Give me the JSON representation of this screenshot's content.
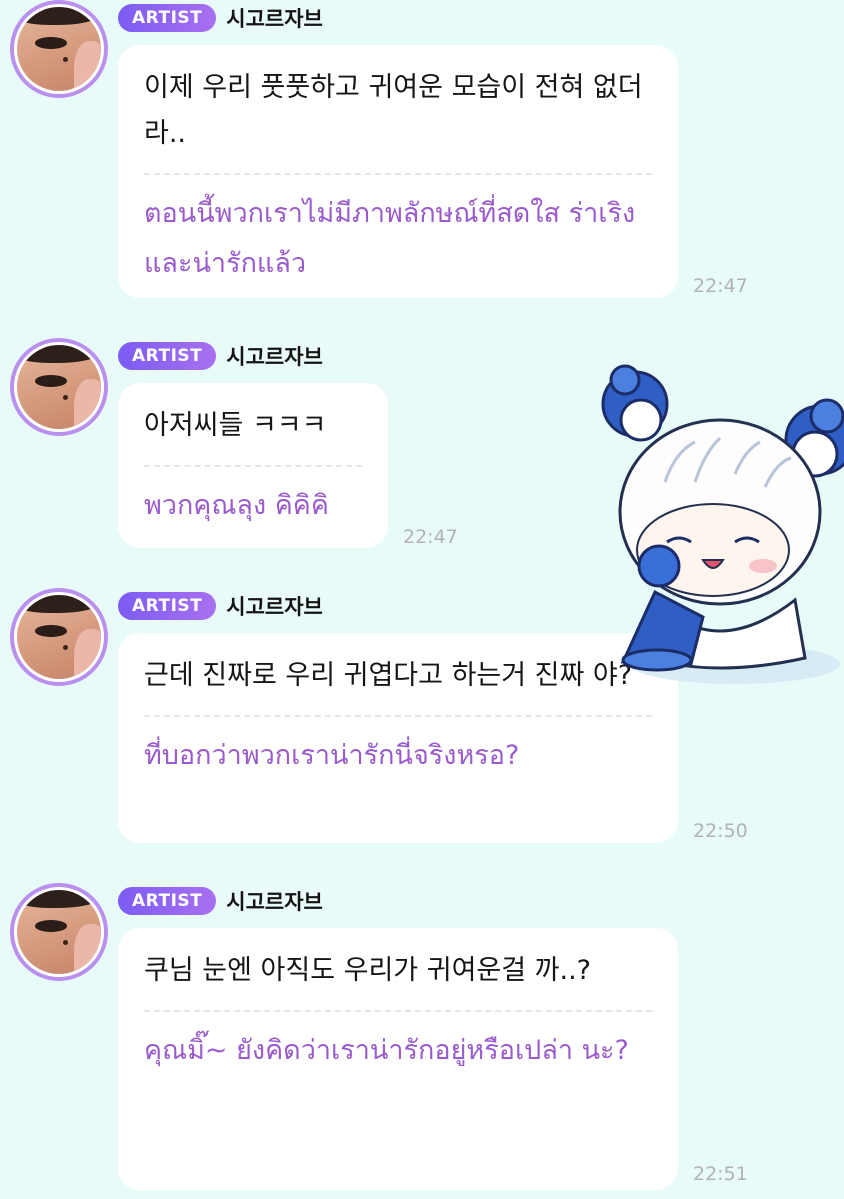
{
  "messages": [
    {
      "badge": "ARTIST",
      "sender": "시고르자브",
      "original": "이제 우리 풋풋하고 귀여운 모습이 전혀 없더라..",
      "translation": "ตอนนี้พวกเราไม่มีภาพลักษณ์ที่สดใส ร่าเริงและน่ารักแล้ว",
      "time": "22:47"
    },
    {
      "badge": "ARTIST",
      "sender": "시고르자브",
      "original": "아저씨들 ㅋㅋㅋ",
      "translation": "พวกคุณลุง คิคิคิ",
      "time": "22:47"
    },
    {
      "badge": "ARTIST",
      "sender": "시고르자브",
      "original": "근데 진짜로 우리 귀엽다고 하는거 진짜 야?",
      "translation": "ที่บอกว่าพวกเราน่ารักนี่จริงหรอ?",
      "time": "22:50"
    },
    {
      "badge": "ARTIST",
      "sender": "시고르자브",
      "original": "쿠님 눈엔 아직도 우리가 귀여운걸 까..?",
      "translation": "คุณมิ๊~ ยังคิดว่าเราน่ารักอยู่หรือเปล่า นะ?",
      "time": "22:51"
    }
  ],
  "theme": {
    "background": "#e9fbf9",
    "bubble": "#ffffff",
    "badge_gradient": [
      "#7c5cf3",
      "#a970f0"
    ],
    "translation_color": "#9a5bcc",
    "time_color": "#b2b2b2",
    "avatar_ring": "#b990ee"
  },
  "sticker": {
    "icon": "chibi-character-sticker-icon"
  }
}
